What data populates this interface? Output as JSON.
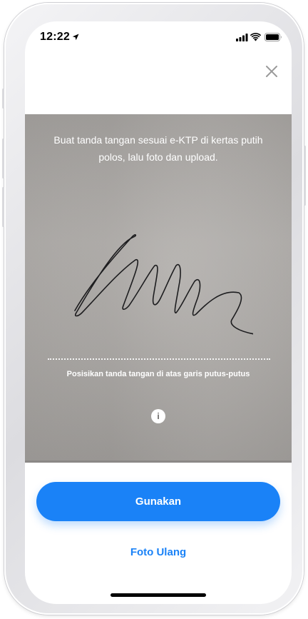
{
  "status_bar": {
    "time": "12:22",
    "icons": [
      "location-arrow-icon",
      "cellular-signal-icon",
      "wifi-icon",
      "battery-icon"
    ]
  },
  "header": {
    "close_icon": "close-icon"
  },
  "photo": {
    "instruction": "Buat tanda tangan sesuai e-KTP di kertas putih polos, lalu foto dan upload.",
    "guide_text": "Posisikan tanda tangan di atas garis putus-putus",
    "info_label": "i"
  },
  "actions": {
    "primary_label": "Gunakan",
    "secondary_label": "Foto Ulang"
  },
  "colors": {
    "accent": "#1a82f7",
    "photo_background": "#aaa7a4"
  }
}
